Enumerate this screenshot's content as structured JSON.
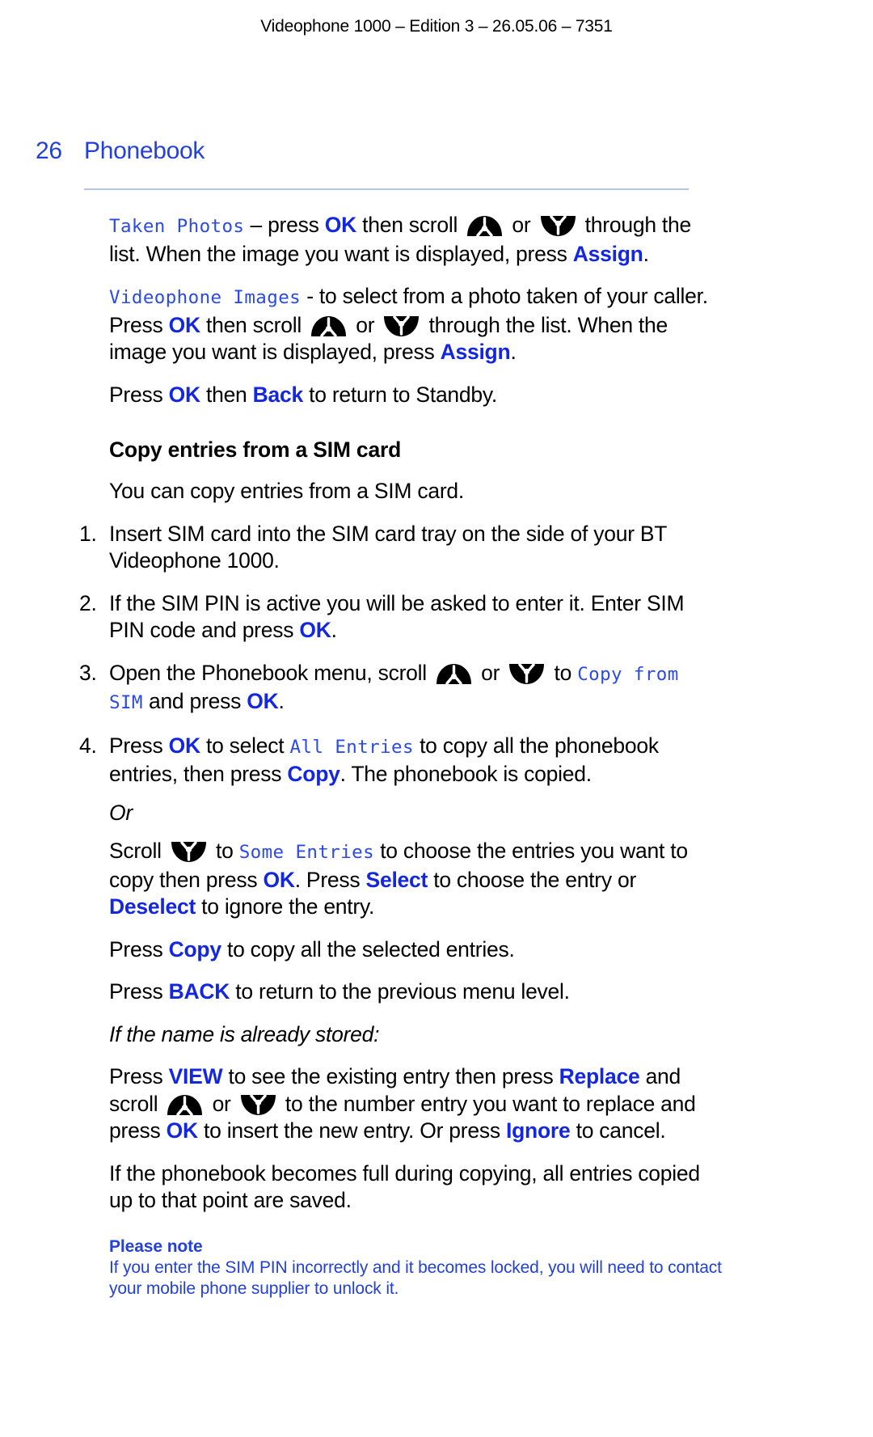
{
  "document": {
    "running_header": "Videophone 1000 – Edition 3 – 26.05.06 – 7351",
    "page_number": "26",
    "section_title": "Phonebook",
    "header_color": "#2341d8",
    "key_color": "#1427e0",
    "lcd_color": "#2b4ae8",
    "rule_color": "#b9c3ea"
  },
  "icons": {
    "scroll_up": "nav-up-icon",
    "scroll_down": "nav-down-icon"
  },
  "content": {
    "p_taken_photos": {
      "lcd_1": "Taken Photos",
      "t_1": " – press ",
      "key_1": "OK",
      "t_2": " then scroll ",
      "t_3": " or ",
      "t_4": " through the list. When the image you want is displayed, press ",
      "key_2": "Assign",
      "t_5": "."
    },
    "p_videophone_images": {
      "lcd_1": "Videophone Images",
      "t_1": " - to select from a photo taken of your caller. Press ",
      "key_1": "OK",
      "t_2": " then scroll ",
      "t_3": " or ",
      "t_4": " through the list. When the image you want is displayed, press ",
      "key_2": "Assign",
      "t_5": "."
    },
    "p_standby": {
      "t_1": "Press ",
      "key_1": "OK",
      "t_2": " then ",
      "key_2": "Back",
      "t_3": " to return to Standby."
    },
    "subhead_copy_sim": "Copy entries from a SIM card",
    "p_intro": "You can copy entries from a SIM card.",
    "step_1": {
      "marker": "1.",
      "text": "Insert SIM card into the SIM card tray on the side of your BT Videophone 1000."
    },
    "step_2": {
      "marker": "2.",
      "t_1": "If the SIM PIN is active you will be asked to enter it. Enter SIM PIN code and press ",
      "key_1": "OK",
      "t_2": "."
    },
    "step_3": {
      "marker": "3.",
      "t_1": "Open the Phonebook menu, scroll ",
      "t_2": " or ",
      "t_3": " to ",
      "lcd_1": "Copy from SIM",
      "t_4": " and press ",
      "key_1": "OK",
      "t_5": "."
    },
    "step_4": {
      "marker": "4.",
      "t_1": "Press ",
      "key_1": "OK",
      "t_2": " to select ",
      "lcd_1": "All Entries",
      "t_3": " to copy all the phonebook entries, then press ",
      "key_2": "Copy",
      "t_4": ". The phonebook is copied."
    },
    "p_or": "Or",
    "p_some_entries": {
      "t_1": "Scroll ",
      "t_2": " to ",
      "lcd_1": "Some Entries",
      "t_3": " to choose the entries you want to copy then press ",
      "key_1": "OK",
      "t_4": ". Press ",
      "key_2": "Select",
      "t_5": " to choose the entry or ",
      "key_3": "Deselect",
      "t_6": " to ignore the entry."
    },
    "p_copy_selected": {
      "t_1": "Press ",
      "key_1": "Copy",
      "t_2": " to copy all the selected entries."
    },
    "p_back": {
      "t_1": "Press ",
      "key_1": "BACK",
      "t_2": " to return to the previous menu level."
    },
    "p_already_stored": "If the name is already stored:",
    "p_replace": {
      "t_1": "Press ",
      "key_1": "VIEW",
      "t_2": " to see the existing entry then press ",
      "key_2": "Replace",
      "t_3": " and scroll ",
      "t_4": " or ",
      "t_5": " to the number entry you want to replace and press ",
      "key_3": "OK",
      "t_6": " to insert the new entry. Or press ",
      "key_4": "Ignore",
      "t_7": " to cancel."
    },
    "p_full": "If the phonebook becomes full during copying, all entries copied up to that point are saved.",
    "note": {
      "title": "Please note",
      "body": "If you enter the SIM PIN incorrectly and it becomes locked, you will need to contact your mobile phone supplier to unlock it."
    }
  }
}
